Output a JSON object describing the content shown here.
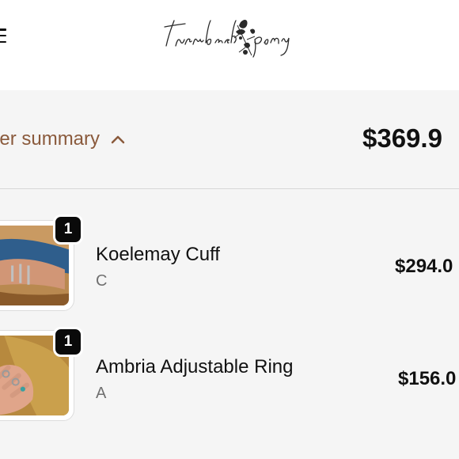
{
  "header": {
    "menu_icon": "hamburger-menu-icon",
    "logo_text": "turnback pony"
  },
  "summary": {
    "toggle_label": "rder summary",
    "toggle_icon": "chevron-up-icon",
    "total": "$369.9"
  },
  "items": [
    {
      "name": "Koelemay Cuff",
      "variant": "C",
      "price": "$294.0",
      "quantity": "1"
    },
    {
      "name": "Ambria Adjustable Ring",
      "variant": "A",
      "price": "$156.0",
      "quantity": "1"
    }
  ],
  "colors": {
    "accent_brown": "#8a5a3c",
    "background": "#f5f5f5",
    "header_bg": "#ffffff",
    "badge_bg": "#0a0a0a"
  }
}
